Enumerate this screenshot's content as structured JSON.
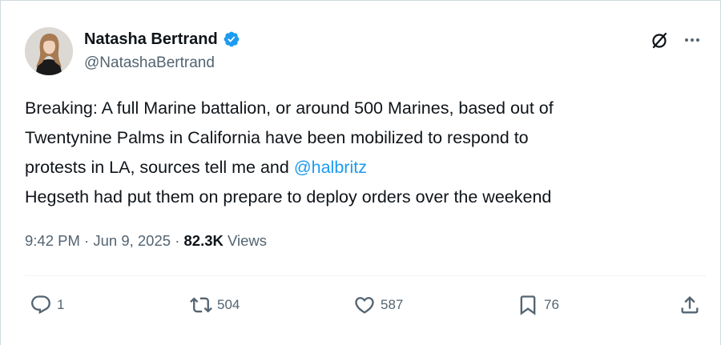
{
  "author": {
    "display_name": "Natasha Bertrand",
    "handle": "@NatashaBertrand",
    "verified_color": "#1d9bf0"
  },
  "top_actions": {
    "grok_icon": "grok-icon",
    "more_icon": "more-horizontal-icon"
  },
  "tweet": {
    "lines": [
      "Breaking: A full Marine battalion, or around 500 Marines, based out of",
      "Twentynine Palms in California have been mobilized to respond to"
    ],
    "line3_prefix": "protests in LA, sources tell me and ",
    "mention": "@halbritz",
    "line4": "Hegseth had put them on prepare to deploy orders over the weekend"
  },
  "meta": {
    "time": "9:42 PM",
    "separator": " · ",
    "date": "Jun 9, 2025",
    "views_count": "82.3K",
    "views_label": " Views"
  },
  "actions": {
    "replies": "1",
    "retweets": "504",
    "likes": "587",
    "bookmarks": "76"
  },
  "colors": {
    "text": "#0f1419",
    "secondary": "#536471",
    "link": "#1d9bf0",
    "border": "#cfd9de"
  }
}
